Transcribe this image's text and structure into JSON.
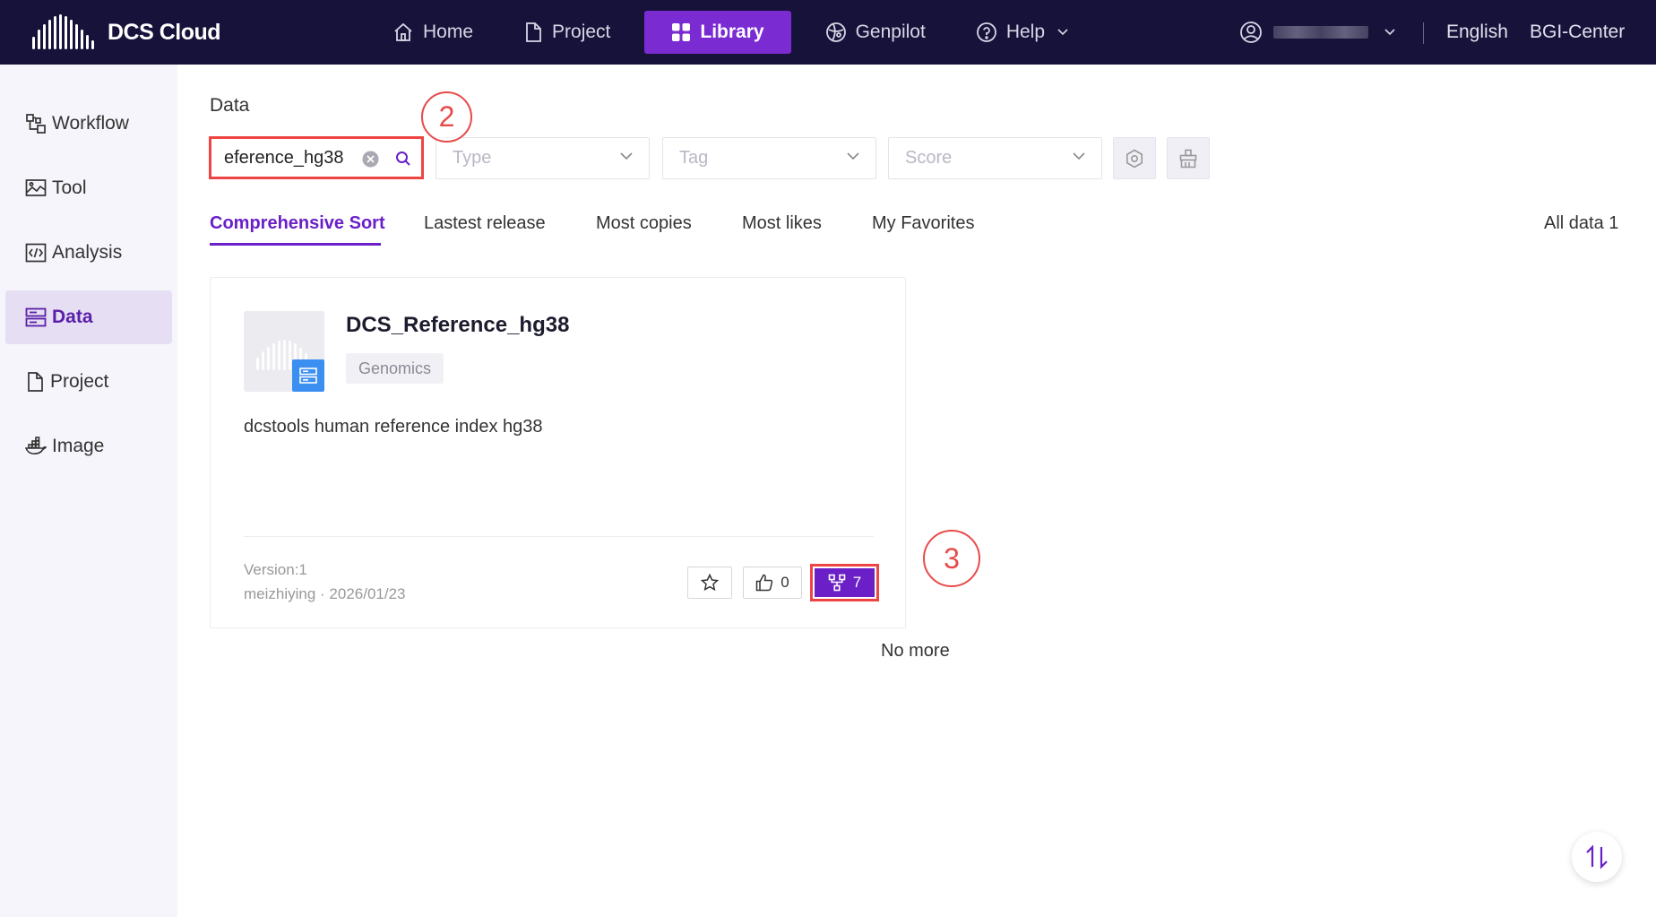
{
  "app": {
    "name": "DCS Cloud"
  },
  "nav": {
    "items": [
      {
        "label": "Home",
        "icon": "home-icon"
      },
      {
        "label": "Project",
        "icon": "file-icon"
      },
      {
        "label": "Library",
        "icon": "grid-icon",
        "active": true
      },
      {
        "label": "Genpilot",
        "icon": "genpilot-icon"
      },
      {
        "label": "Help",
        "icon": "help-icon"
      }
    ],
    "language": "English",
    "center": "BGI-Center"
  },
  "sidebar": {
    "items": [
      {
        "label": "Workflow",
        "icon": "workflow-icon"
      },
      {
        "label": "Tool",
        "icon": "tool-icon"
      },
      {
        "label": "Analysis",
        "icon": "code-icon"
      },
      {
        "label": "Data",
        "icon": "data-icon",
        "active": true
      },
      {
        "label": "Project",
        "icon": "file-icon"
      },
      {
        "label": "Image",
        "icon": "docker-icon"
      }
    ]
  },
  "main": {
    "section_label": "Data",
    "search": {
      "value": "eference_hg38"
    },
    "filters": {
      "type": "Type",
      "tag": "Tag",
      "score": "Score"
    },
    "sort_tabs": [
      "Comprehensive Sort",
      "Lastest release",
      "Most copies",
      "Most likes",
      "My Favorites"
    ],
    "all_data": "All data 1",
    "card": {
      "title": "DCS_Reference_hg38",
      "tag": "Genomics",
      "description": "dcstools human reference index hg38",
      "version": "Version:1",
      "meta": "meizhiying · 2026/01/23",
      "likes": "0",
      "copies": "7"
    },
    "no_more": "No more"
  },
  "annotations": {
    "step2": "2",
    "step3": "3"
  },
  "colors": {
    "topbar": "#17123a",
    "accent": "#6a1fc7",
    "highlight": "#ef4444"
  }
}
